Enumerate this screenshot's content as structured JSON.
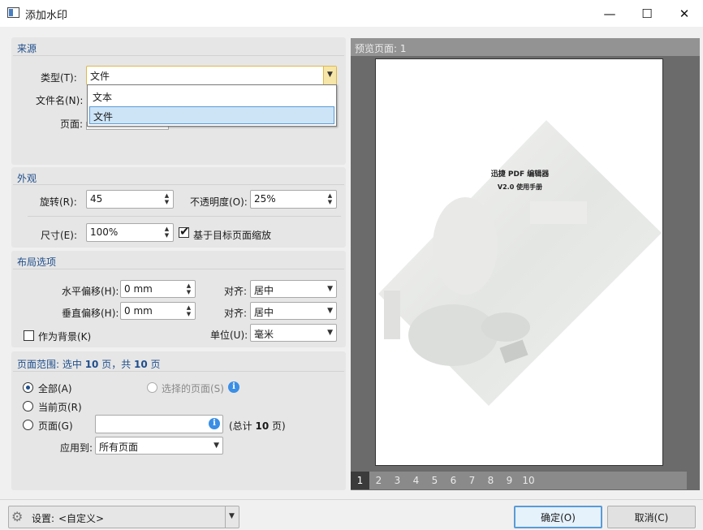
{
  "window": {
    "title": "添加水印",
    "minimize_glyph": "—",
    "maximize_glyph": "☐",
    "close_glyph": "✕"
  },
  "source": {
    "section_title": "来源",
    "type_label": "类型(T):",
    "type_value": "文件",
    "filename_label": "文件名(N):",
    "page_label": "页面:",
    "dropdown_options": [
      "文本",
      "文件"
    ],
    "dropdown_selected": "文件"
  },
  "appearance": {
    "section_title": "外观",
    "rotation_label": "旋转(R):",
    "rotation_value": "45",
    "opacity_label": "不透明度(O):",
    "opacity_value": "25%",
    "size_label": "尺寸(E):",
    "size_value": "100%",
    "scale_checkbox_label": "基于目标页面缩放",
    "scale_checked": true
  },
  "layout": {
    "section_title": "布局选项",
    "h_offset_label": "水平偏移(H):",
    "h_offset_value": "0 mm",
    "v_offset_label": "垂直偏移(H):",
    "v_offset_value": "0 mm",
    "align1_label": "对齐:",
    "align1_value": "居中",
    "align2_label": "对齐:",
    "align2_value": "居中",
    "background_label": "作为背景(K)",
    "background_checked": false,
    "unit_label": "单位(U):",
    "unit_value": "毫米"
  },
  "page_range": {
    "title_prefix": "页面范围: 选中 ",
    "selected_count": "10",
    "title_mid": " 页，共 ",
    "total_count": "10",
    "title_suffix": " 页",
    "all_label": "全部(A)",
    "current_label": "当前页(R)",
    "pages_label": "页面(G)",
    "selected_pages_label": "选择的页面(S)",
    "total_prefix": "(总计 ",
    "total_num": "10",
    "total_suffix": " 页)",
    "apply_label": "应用到:",
    "apply_value": "所有页面",
    "selected_option": "all"
  },
  "preview": {
    "header": "预览页面: 1",
    "watermark_line1": "迅捷 PDF 编辑器",
    "watermark_line2": "V2.0 使用手册",
    "pages": [
      "1",
      "2",
      "3",
      "4",
      "5",
      "6",
      "7",
      "8",
      "9",
      "10"
    ],
    "current_page": "1"
  },
  "footer": {
    "settings_label": "设置:",
    "settings_value": "<自定义>",
    "ok_label": "确定(O)",
    "cancel_label": "取消(C)"
  },
  "colors": {
    "accent": "#1f4e8c",
    "dropdown_highlight": "#cde4f7",
    "info_icon": "#3a8ee6"
  }
}
